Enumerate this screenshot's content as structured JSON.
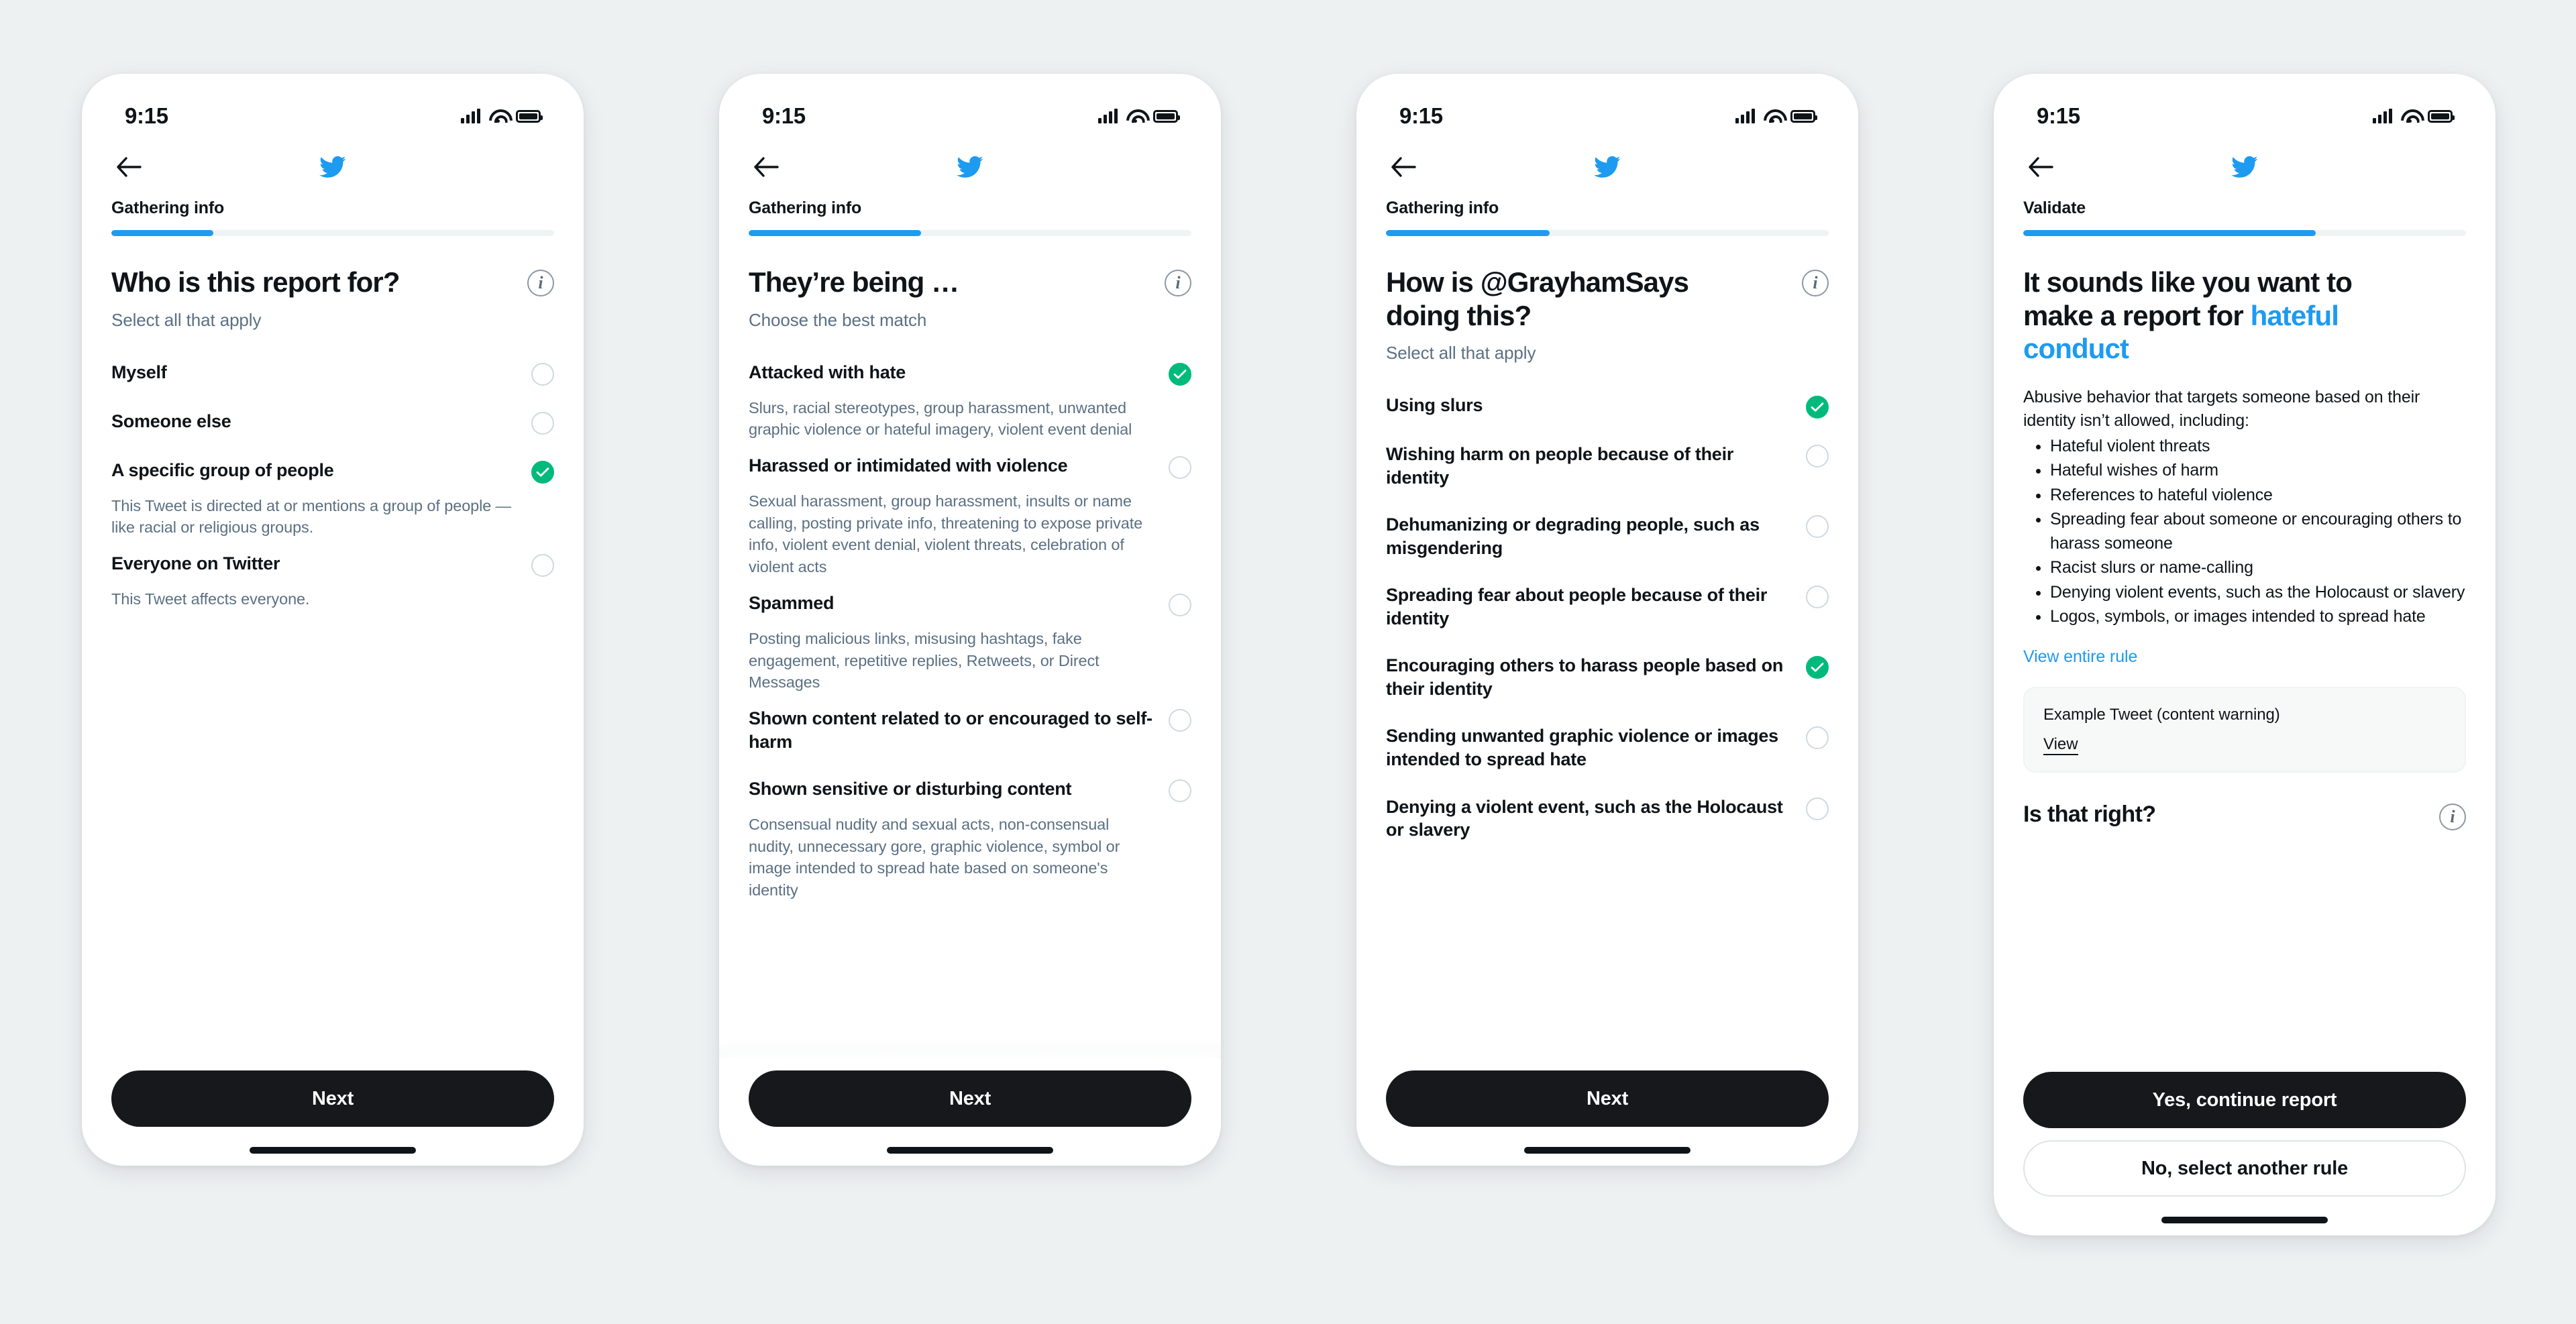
{
  "statusbar": {
    "time": "9:15",
    "signal_icon": "cellular-signal-icon",
    "wifi_icon": "wifi-icon",
    "battery_icon": "battery-icon"
  },
  "brand": {
    "logo_icon": "twitter-bird-logo",
    "accent_blue": "#1d9bf0",
    "selected_green": "#00ba7c",
    "text_primary": "#0f1419",
    "text_secondary": "#5b7083",
    "button_dark": "#16181c"
  },
  "screens": [
    {
      "id": "who-is-this-report-for",
      "back_icon": "back-arrow-icon",
      "step_label": "Gathering info",
      "progress_percent": 23,
      "title": "Who is this report for?",
      "info_icon": "info-icon",
      "subtitle": "Select all that apply",
      "options": [
        {
          "label": "Myself",
          "desc": "",
          "selected": false
        },
        {
          "label": "Someone else",
          "desc": "",
          "selected": false
        },
        {
          "label": "A specific group of people",
          "desc": "This Tweet is directed at or mentions a group of people — like racial or religious groups.",
          "selected": true
        },
        {
          "label": "Everyone on Twitter",
          "desc": "This Tweet affects everyone.",
          "selected": false
        }
      ],
      "primary_button": "Next"
    },
    {
      "id": "theyre-being",
      "back_icon": "back-arrow-icon",
      "step_label": "Gathering info",
      "progress_percent": 39,
      "title": "They’re being …",
      "info_icon": "info-icon",
      "subtitle": "Choose the best match",
      "options": [
        {
          "label": "Attacked with hate",
          "desc": "Slurs, racial stereotypes, group harassment, unwanted graphic violence or hateful imagery, violent event denial",
          "selected": true
        },
        {
          "label": "Harassed or intimidated with violence",
          "desc": "Sexual harassment, group harassment, insults or name calling, posting private info, threatening to expose private info, violent event denial, violent threats, celebration of violent acts",
          "selected": false
        },
        {
          "label": "Spammed",
          "desc": "Posting malicious links, misusing hashtags, fake engagement, repetitive replies, Retweets, or Direct Messages",
          "selected": false
        },
        {
          "label": "Shown content related to or encouraged to self-harm",
          "desc": "",
          "selected": false
        },
        {
          "label": "Shown sensitive or disturbing content",
          "desc": "Consensual nudity and sexual acts, non-consensual nudity, unnecessary gore, graphic violence, symbol or image intended to spread hate based on someone's identity",
          "selected": false
        }
      ],
      "primary_button": "Next"
    },
    {
      "id": "how-is-user-doing-this",
      "back_icon": "back-arrow-icon",
      "step_label": "Gathering info",
      "progress_percent": 37,
      "title": "How is @GrayhamSays doing this?",
      "info_icon": "info-icon",
      "subtitle": "Select all that apply",
      "options": [
        {
          "label": "Using slurs",
          "desc": "",
          "selected": true
        },
        {
          "label": "Wishing harm on people because of their identity",
          "desc": "",
          "selected": false
        },
        {
          "label": "Dehumanizing or degrading people, such as misgendering",
          "desc": "",
          "selected": false
        },
        {
          "label": "Spreading fear about people because of their identity",
          "desc": "",
          "selected": false
        },
        {
          "label": "Encouraging others to harass people based on their identity",
          "desc": "",
          "selected": true
        },
        {
          "label": "Sending unwanted graphic violence or images intended to spread hate",
          "desc": "",
          "selected": false
        },
        {
          "label": "Denying a violent event, such as the Holocaust or slavery",
          "desc": "",
          "selected": false
        }
      ],
      "primary_button": "Next"
    }
  ],
  "validate_screen": {
    "id": "validate",
    "back_icon": "back-arrow-icon",
    "step_label": "Validate",
    "progress_percent": 66,
    "info_icon": "info-icon",
    "title_prefix": "It sounds like you want to make a report for ",
    "title_highlight": "hateful conduct",
    "body_intro": "Abusive behavior that targets someone based on their identity isn’t allowed, including:",
    "bullets": [
      "Hateful violent threats",
      "Hateful wishes of harm",
      "References to hateful violence",
      "Spreading fear about someone or encouraging others to harass someone",
      "Racist slurs or name-calling",
      "Denying violent events, such as the Holocaust or slavery",
      "Logos, symbols, or images intended to spread hate"
    ],
    "rule_link": "View entire rule",
    "example_card": {
      "caption": "Example Tweet (content warning)",
      "view_label": "View"
    },
    "confirm_question": "Is that right?",
    "primary_button": "Yes, continue report",
    "secondary_button": "No, select another rule"
  }
}
